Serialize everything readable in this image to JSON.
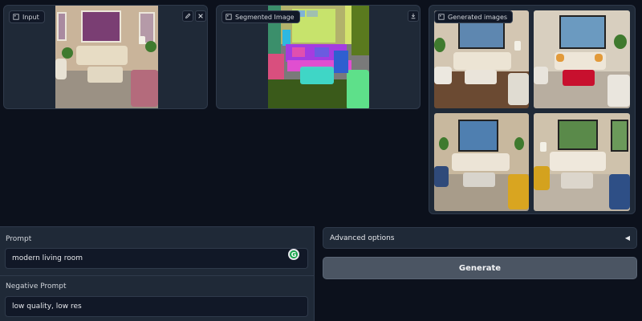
{
  "input_panel": {
    "label": "Input",
    "icon": "image-icon"
  },
  "segmented_panel": {
    "label": "Segmented Image",
    "icon": "image-icon"
  },
  "generated_panel": {
    "label": "Generated images",
    "icon": "image-icon"
  },
  "prompt": {
    "label": "Prompt",
    "value": "modern living room",
    "badge": "G"
  },
  "negative_prompt": {
    "label": "Negative Prompt",
    "value": "low quality, low res"
  },
  "advanced": {
    "label": "Advanced options",
    "arrow": "◀"
  },
  "generate": {
    "label": "Generate"
  }
}
